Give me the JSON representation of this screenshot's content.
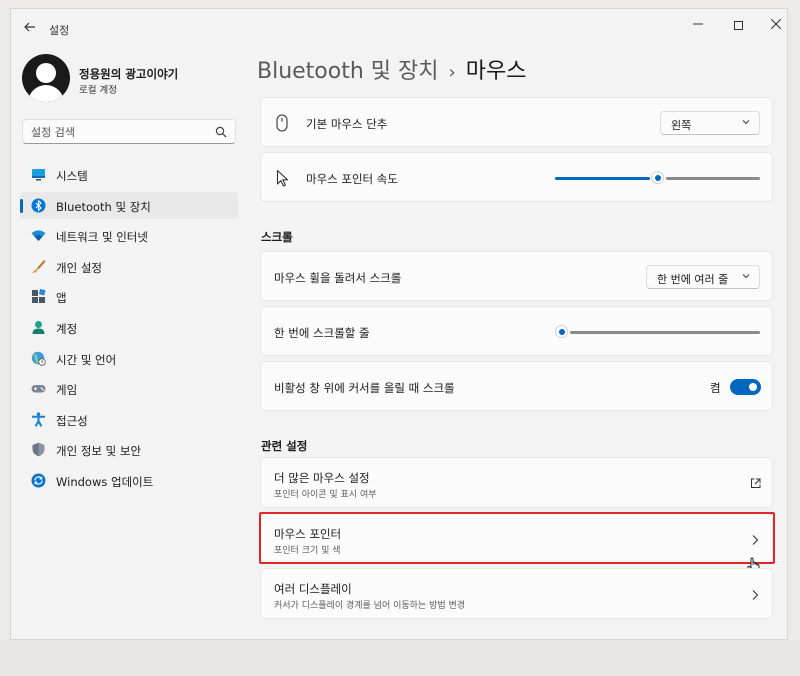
{
  "window": {
    "title": "설정",
    "controls": {
      "minimize": "—",
      "close": "✕"
    }
  },
  "profile": {
    "name": "정용원의 광고이야기",
    "subtitle": "로컬 계정"
  },
  "search": {
    "placeholder": "설정 검색"
  },
  "nav": {
    "items": [
      {
        "label": "시스템",
        "icon": "system-icon"
      },
      {
        "label": "Bluetooth 및 장치",
        "icon": "bluetooth-icon",
        "active": true
      },
      {
        "label": "네트워크 및 인터넷",
        "icon": "network-icon"
      },
      {
        "label": "개인 설정",
        "icon": "personalization-icon"
      },
      {
        "label": "앱",
        "icon": "apps-icon"
      },
      {
        "label": "계정",
        "icon": "accounts-icon"
      },
      {
        "label": "시간 및 언어",
        "icon": "time-language-icon"
      },
      {
        "label": "게임",
        "icon": "gaming-icon"
      },
      {
        "label": "접근성",
        "icon": "accessibility-icon"
      },
      {
        "label": "개인 정보 및 보안",
        "icon": "privacy-icon"
      },
      {
        "label": "Windows 업데이트",
        "icon": "update-icon"
      }
    ]
  },
  "breadcrumb": {
    "parent": "Bluetooth 및 장치",
    "separator": "›",
    "current": "마우스"
  },
  "settings": {
    "primary_button": {
      "label": "기본 마우스 단추",
      "value": "왼쪽"
    },
    "pointer_speed": {
      "label": "마우스 포인터 속도",
      "level": 0.5
    }
  },
  "scroll": {
    "title": "스크롤",
    "wheel": {
      "label": "마우스 휠을 돌려서 스크롤",
      "value": "한 번에 여러 줄"
    },
    "lines": {
      "label": "한 번에 스크롤할 줄",
      "level": 0.03
    },
    "inactive": {
      "label": "비활성 창 위에 커서를 올릴 때 스크롤",
      "state": "켬",
      "on": true
    }
  },
  "related": {
    "title": "관련 설정",
    "items": [
      {
        "title": "더 많은 마우스 설정",
        "subtitle": "포인터 아이콘 및 표시 여부",
        "icon": "open-external-icon"
      },
      {
        "title": "마우스 포인터",
        "subtitle": "포인터 크기 및 색",
        "icon": "chevron-right-icon"
      },
      {
        "title": "여러 디스플레이",
        "subtitle": "커서가 디스플레이 경계를 넘어 이동하는 방법 변경",
        "icon": "chevron-right-icon"
      }
    ]
  },
  "colors": {
    "accent": "#0067c0",
    "highlight_border": "#e0262b",
    "background": "#f3f3f3",
    "card": "#fbfbfb"
  }
}
